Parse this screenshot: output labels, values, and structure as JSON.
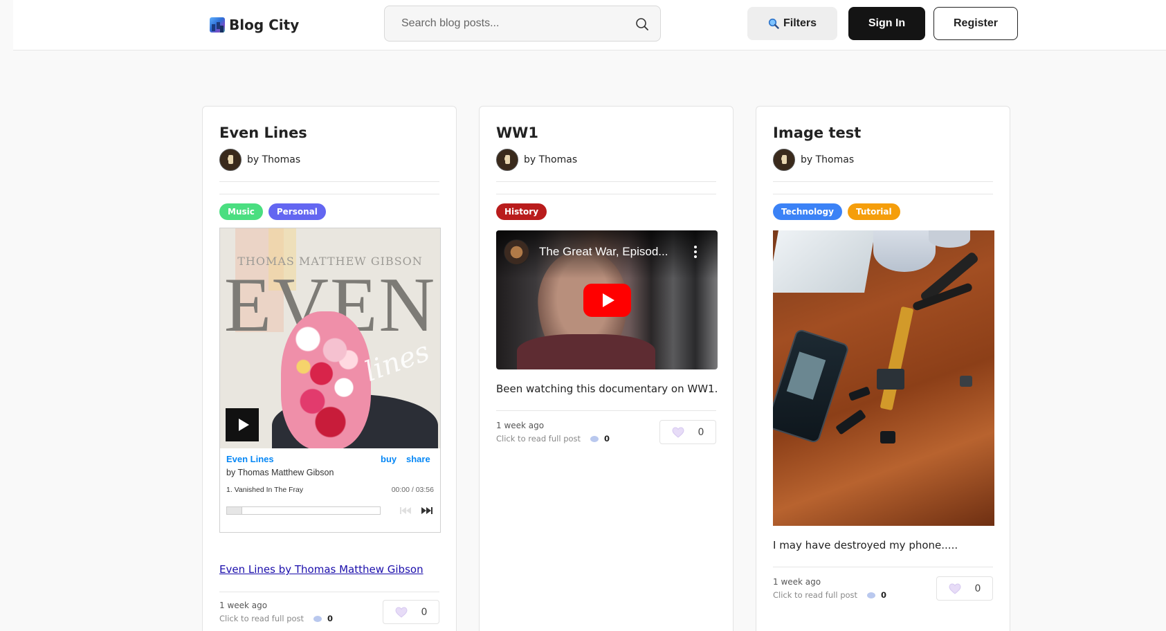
{
  "header": {
    "logo_text": "Blog City",
    "search_placeholder": "Search blog posts...",
    "filters_label": "Filters",
    "signin_label": "Sign In",
    "register_label": "Register"
  },
  "colors": {
    "tag_music": "#4ade80",
    "tag_personal": "#6366f1",
    "tag_history": "#b91c1c",
    "tag_technology": "#3b82f6",
    "tag_tutorial": "#f59e0b",
    "primary_button": "#141414",
    "link": "#1a0dab",
    "bandcamp_link": "#0687f5"
  },
  "posts": [
    {
      "title": "Even Lines",
      "author": "by Thomas",
      "tags": [
        "Music",
        "Personal"
      ],
      "embed": {
        "type": "bandcamp",
        "art_artist": "THOMAS MATTHEW GIBSON",
        "art_title": "EVEN",
        "art_subtitle": "lines",
        "album_title": "Even Lines",
        "buy": "buy",
        "share": "share",
        "artist": "by Thomas Matthew Gibson",
        "track": "1.  Vanished In The Fray",
        "time": "00:00 / 03:56"
      },
      "link_text": "Even Lines by Thomas Matthew Gibson",
      "time_ago": "1 week ago",
      "read_more": "Click to read full post",
      "comments": "0",
      "likes": "0"
    },
    {
      "title": "WW1",
      "author": "by Thomas",
      "tags": [
        "History"
      ],
      "embed": {
        "type": "youtube",
        "video_title": "The Great War, Episod..."
      },
      "description": "Been watching this documentary on WW1.",
      "time_ago": "1 week ago",
      "read_more": "Click to read full post",
      "comments": "0",
      "likes": "0"
    },
    {
      "title": "Image test",
      "author": "by Thomas",
      "tags": [
        "Technology",
        "Tutorial"
      ],
      "embed": {
        "type": "image",
        "alt": "disassembled phone on wooden table"
      },
      "description": "I may have destroyed my phone.....",
      "time_ago": "1 week ago",
      "read_more": "Click to read full post",
      "comments": "0",
      "likes": "0"
    }
  ]
}
